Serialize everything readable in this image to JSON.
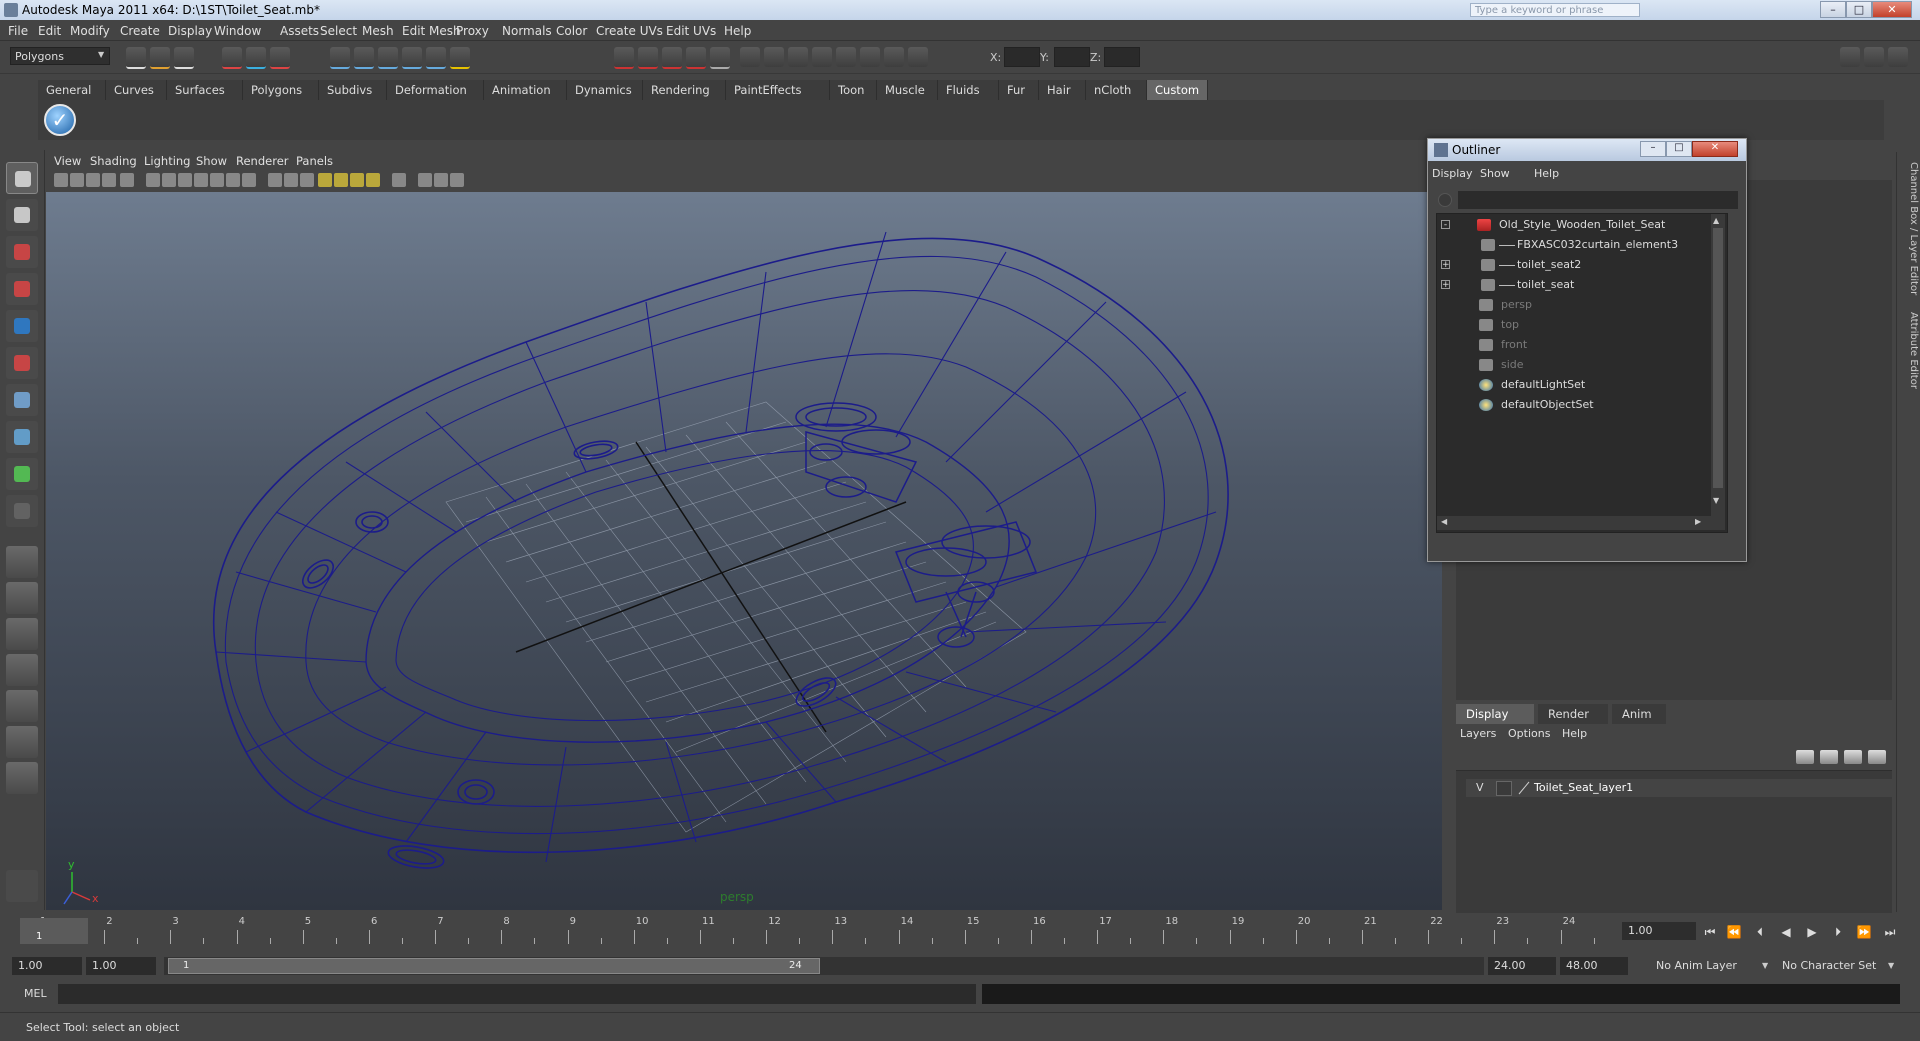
{
  "window": {
    "title": "Autodesk Maya 2011 x64: D:\\1ST\\Toilet_Seat.mb*",
    "search_placeholder": "Type a keyword or phrase",
    "minimize": "–",
    "maximize": "□",
    "close": "✕"
  },
  "menubar": [
    "File",
    "Edit",
    "Modify",
    "Create",
    "Display",
    "Window",
    "Assets",
    "Select",
    "Mesh",
    "Edit Mesh",
    "Proxy",
    "Normals",
    "Color",
    "Create UVs",
    "Edit UVs",
    "Help"
  ],
  "statusline": {
    "mode": "Polygons",
    "x_label": "X:",
    "y_label": "Y:",
    "z_label": "Z:"
  },
  "shelf_tabs": [
    "General",
    "Curves",
    "Surfaces",
    "Polygons",
    "Subdivs",
    "Deformation",
    "Animation",
    "Dynamics",
    "Rendering",
    "PaintEffects",
    "Toon",
    "Muscle",
    "Fluids",
    "Fur",
    "Hair",
    "nCloth",
    "Custom"
  ],
  "shelf_active": "Custom",
  "viewport": {
    "menus": [
      "View",
      "Shading",
      "Lighting",
      "Show",
      "Renderer",
      "Panels"
    ],
    "camera": "persp",
    "axis_y": "y",
    "axis_x": "x"
  },
  "outliner": {
    "title": "Outliner",
    "menus": [
      "Display",
      "Show",
      "Help"
    ],
    "items": [
      {
        "label": "Old_Style_Wooden_Toilet_Seat",
        "depth": 0,
        "expand": "-",
        "dim": false,
        "icon": "mesh-group-icon"
      },
      {
        "label": "FBXASC032curtain_element3",
        "depth": 1,
        "expand": "",
        "dim": false,
        "icon": "transform-icon"
      },
      {
        "label": "toilet_seat2",
        "depth": 1,
        "expand": "+",
        "dim": false,
        "icon": "transform-icon"
      },
      {
        "label": "toilet_seat",
        "depth": 1,
        "expand": "+",
        "dim": false,
        "icon": "transform-icon"
      },
      {
        "label": "persp",
        "depth": 0,
        "expand": "",
        "dim": true,
        "icon": "camera-icon"
      },
      {
        "label": "top",
        "depth": 0,
        "expand": "",
        "dim": true,
        "icon": "camera-icon"
      },
      {
        "label": "front",
        "depth": 0,
        "expand": "",
        "dim": true,
        "icon": "camera-icon"
      },
      {
        "label": "side",
        "depth": 0,
        "expand": "",
        "dim": true,
        "icon": "camera-icon"
      },
      {
        "label": "defaultLightSet",
        "depth": 0,
        "expand": "",
        "dim": false,
        "icon": "set-icon"
      },
      {
        "label": "defaultObjectSet",
        "depth": 0,
        "expand": "",
        "dim": false,
        "icon": "set-icon"
      }
    ]
  },
  "dock": {
    "vtabs": [
      "Channel Box / Layer Editor",
      "Attribute Editor"
    ],
    "layer_tabs": [
      "Display",
      "Render",
      "Anim"
    ],
    "layer_tab_active": "Display",
    "layer_menus": [
      "Layers",
      "Options",
      "Help"
    ],
    "layers": [
      {
        "visible": "V",
        "name": "Toilet_Seat_layer1"
      }
    ]
  },
  "timeline": {
    "ticks": [
      1,
      2,
      3,
      4,
      5,
      6,
      7,
      8,
      9,
      10,
      11,
      12,
      13,
      14,
      15,
      16,
      17,
      18,
      19,
      20,
      21,
      22,
      23,
      24
    ],
    "current_frame": "1",
    "current_frame_field": "1.00"
  },
  "range": {
    "start_time": "1.00",
    "playback_start": "1.00",
    "slider_start": "1",
    "slider_end": "24",
    "playback_end": "24.00",
    "end_time": "48.00",
    "anim_layer": "No Anim Layer",
    "char_set": "No Character Set"
  },
  "cmdline": {
    "label": "MEL"
  },
  "helpline": {
    "text": "Select Tool: select an object"
  },
  "colors": {
    "wire": "#1c1c8a",
    "accent": "#1a5fa5"
  }
}
